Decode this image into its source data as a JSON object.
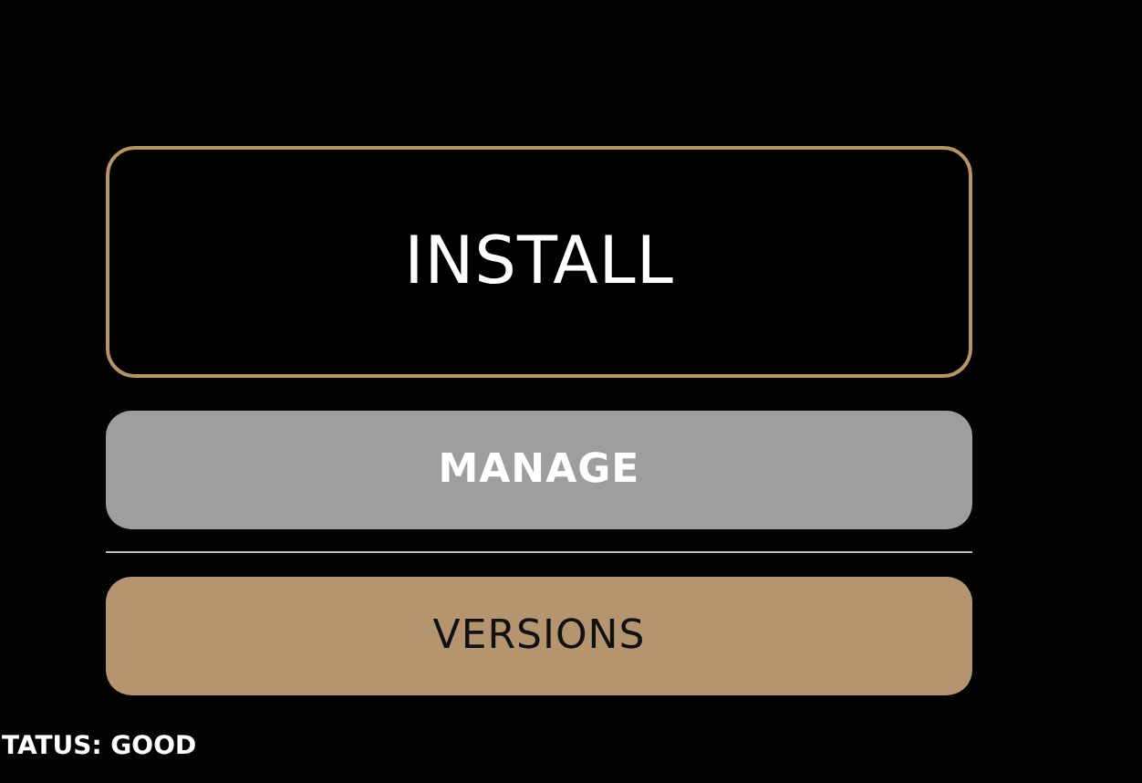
{
  "buttons": [
    {
      "label": "INSTALL",
      "kind": "primary"
    },
    {
      "label": "MANAGE",
      "kind": "secondary"
    },
    {
      "label": "VERSIONS",
      "kind": "accent"
    }
  ],
  "status": "TATUS: GOOD"
}
